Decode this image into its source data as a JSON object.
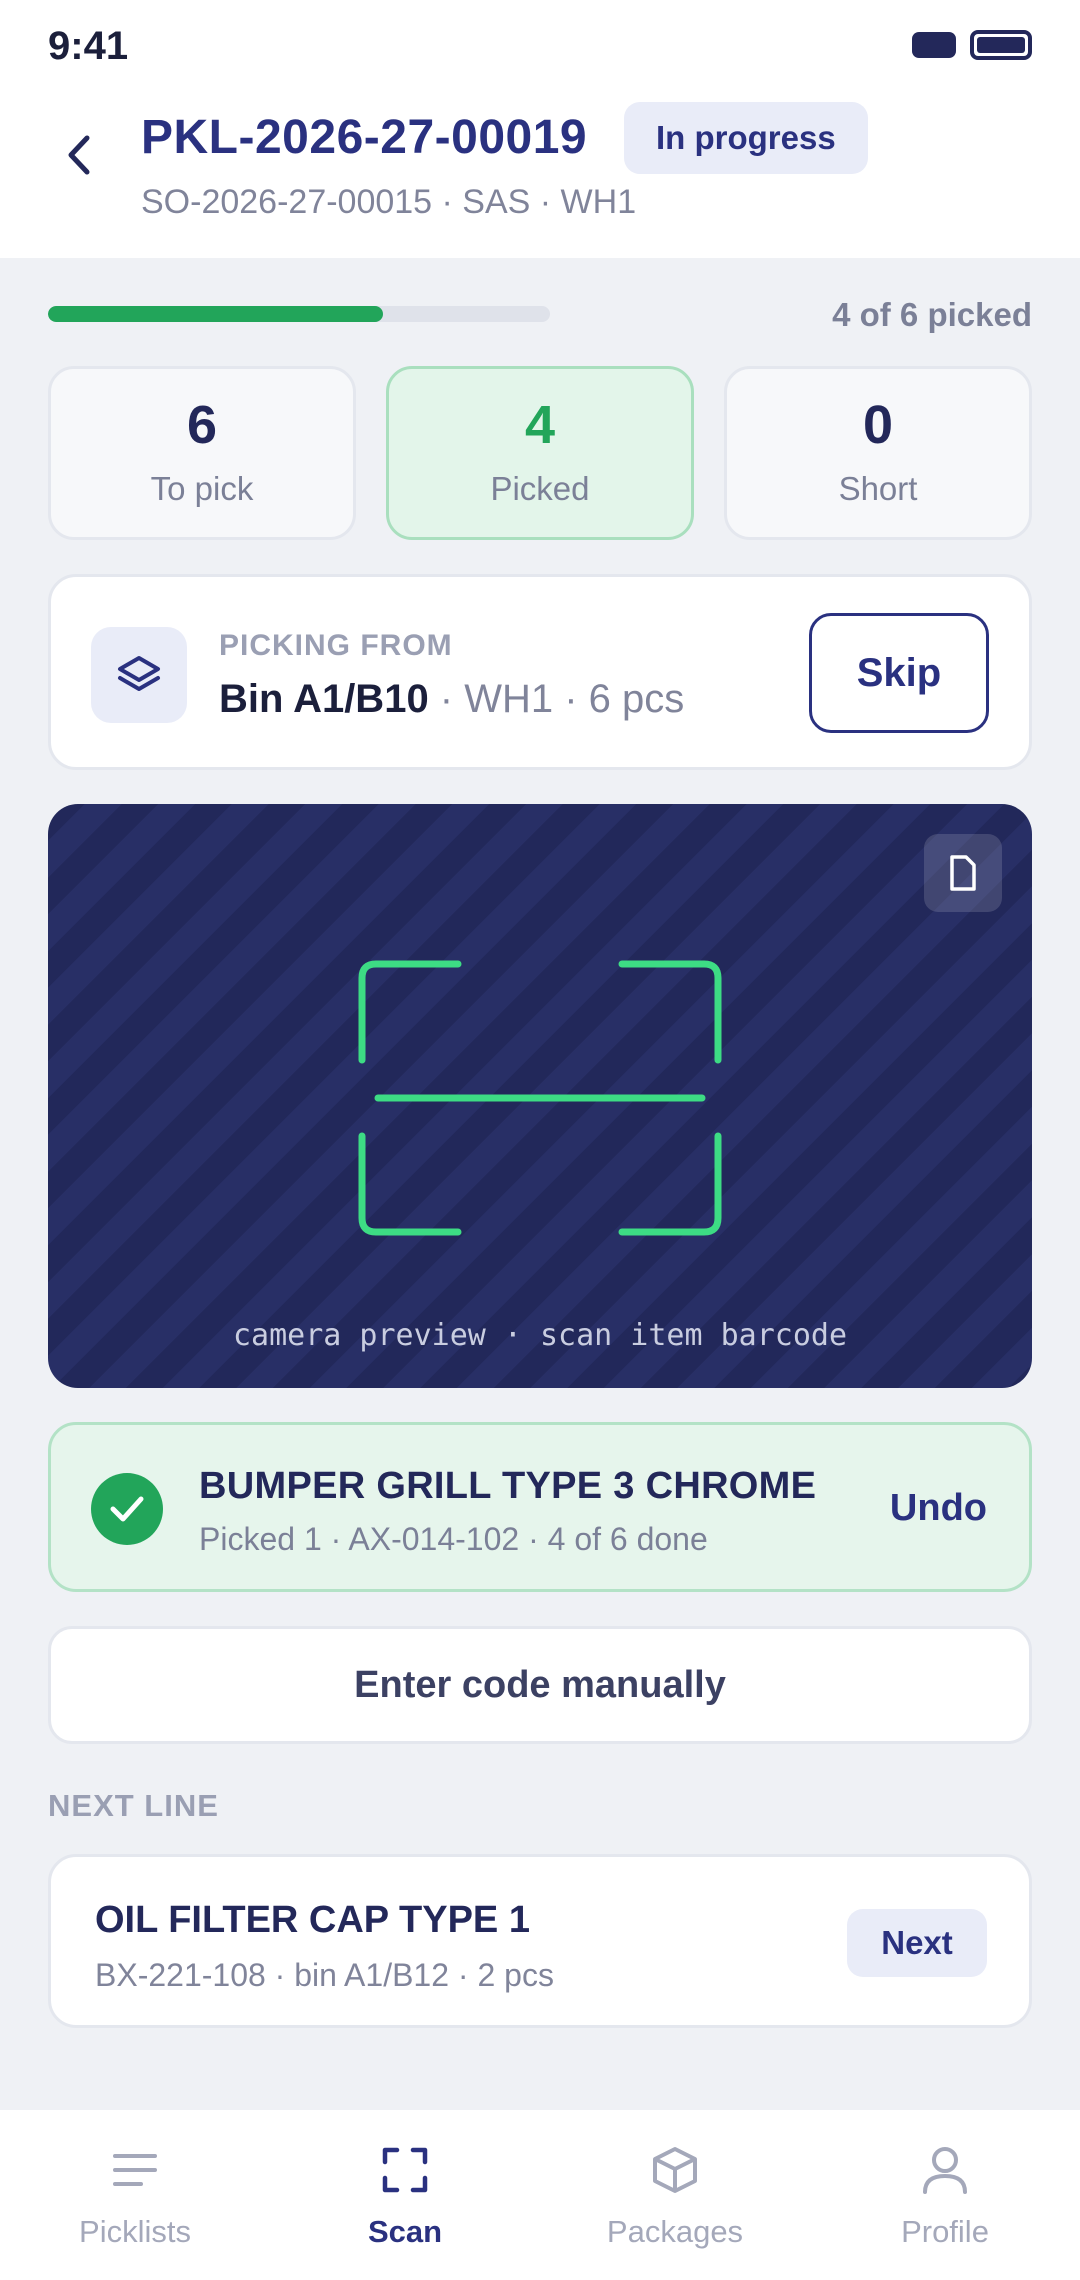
{
  "status_bar": {
    "time": "9:41"
  },
  "header": {
    "title": "PKL-2026-27-00019",
    "status": "In progress",
    "subtitle": "SO-2026-27-00015 · SAS · WH1"
  },
  "progress": {
    "fraction": 0.667,
    "text": "4 of 6 picked"
  },
  "stats": [
    {
      "value": "6",
      "label": "To pick"
    },
    {
      "value": "4",
      "label": "Picked"
    },
    {
      "value": "0",
      "label": "Short"
    }
  ],
  "picking_from": {
    "caption": "PICKING FROM",
    "bin": "Bin A1/B10",
    "details": " · WH1 · 6 pcs",
    "skip_label": "Skip"
  },
  "camera": {
    "caption": "camera preview · scan item barcode"
  },
  "scan_result": {
    "title": "BUMPER GRILL TYPE 3 CHROME",
    "subtitle": "Picked 1 · AX-014-102 · 4 of 6 done",
    "undo_label": "Undo"
  },
  "manual_entry_label": "Enter code manually",
  "next_line": {
    "caption": "NEXT LINE",
    "title": "OIL FILTER CAP TYPE 1",
    "subtitle": "BX-221-108 · bin A1/B12 · 2 pcs",
    "next_label": "Next"
  },
  "nav": [
    {
      "label": "Picklists",
      "icon": "list-icon"
    },
    {
      "label": "Scan",
      "icon": "scan-icon",
      "active": true
    },
    {
      "label": "Packages",
      "icon": "package-icon"
    },
    {
      "label": "Profile",
      "icon": "profile-icon"
    }
  ],
  "colors": {
    "accent": "#2a3180",
    "success": "#22a55a",
    "camera_bg": "#22285a",
    "scan_frame": "#3ddc84"
  }
}
